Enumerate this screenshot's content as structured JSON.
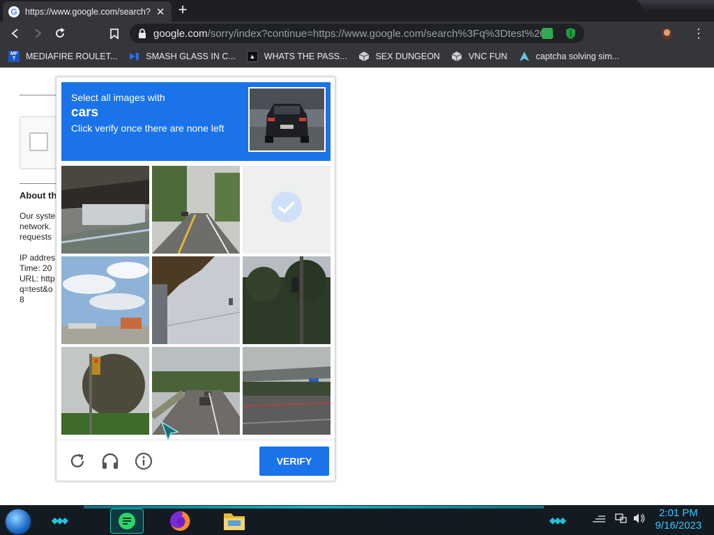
{
  "tab": {
    "title": "https://www.google.com/search?q",
    "close": "✕",
    "new_tab": "+"
  },
  "address_bar": {
    "host": "google.com",
    "path": "/sorry/index?continue=https://www.google.com/search%3Fq%3Dtest%26..."
  },
  "bookmarks": [
    {
      "label": "MEDIAFIRE ROULET...",
      "icon": "mediafire-icon"
    },
    {
      "label": "SMASH GLASS IN C...",
      "icon": "visual-studio-icon"
    },
    {
      "label": "WHATS THE PASS...",
      "icon": "terminal-icon"
    },
    {
      "label": "SEX DUNGEON",
      "icon": "cube-icon"
    },
    {
      "label": "VNC FUN",
      "icon": "cube-icon"
    },
    {
      "label": "captcha solving sim...",
      "icon": "arch-icon"
    }
  ],
  "background_page": {
    "heading": "About th",
    "lines": [
      "Our syste",
      "network.",
      "requests"
    ],
    "details": [
      "IP addres",
      "Time: 20",
      "URL: http",
      "q=test&o",
      "8"
    ]
  },
  "captcha": {
    "instruction": "Select all images with",
    "target": "cars",
    "hint": "Click verify once there are none left",
    "tiles": [
      {
        "name": "tile-overpass",
        "selected": false
      },
      {
        "name": "tile-road-with-car",
        "selected": false
      },
      {
        "name": "tile-selected-blank",
        "selected": true
      },
      {
        "name": "tile-sky-buildings",
        "selected": false
      },
      {
        "name": "tile-palm-tree",
        "selected": false
      },
      {
        "name": "tile-trees-traffic-light",
        "selected": false
      },
      {
        "name": "tile-traffic-light-tree",
        "selected": false
      },
      {
        "name": "tile-road-cars",
        "selected": false
      },
      {
        "name": "tile-highway-bridge",
        "selected": false
      }
    ],
    "verify_label": "VERIFY",
    "accent_color": "#1a73e8"
  },
  "taskbar": {
    "time": "2:01 PM",
    "date": "9/16/2023"
  }
}
